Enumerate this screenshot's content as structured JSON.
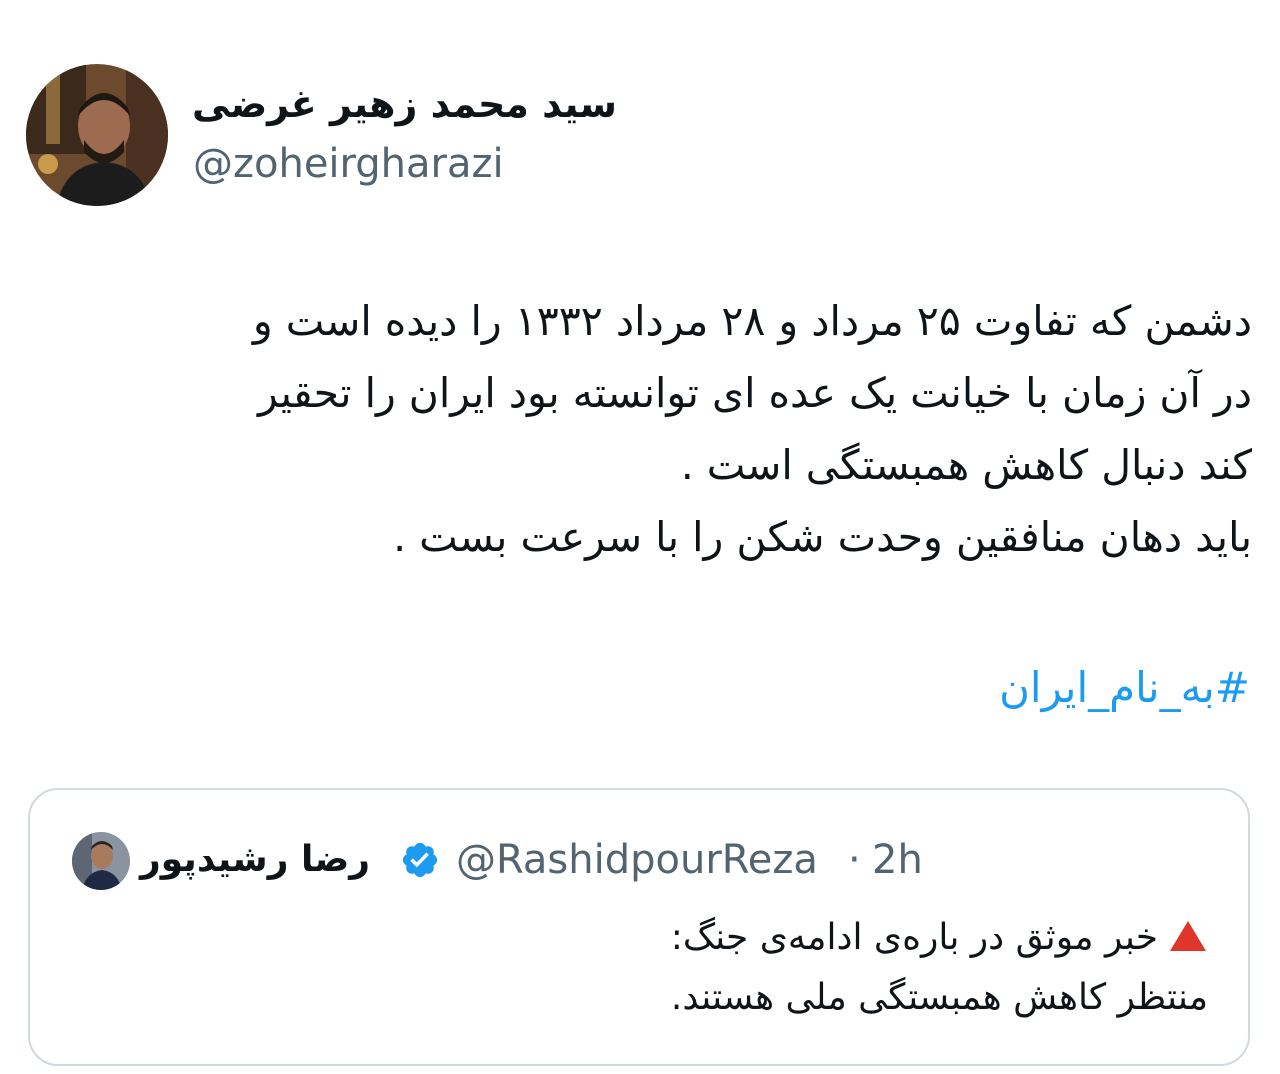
{
  "author": {
    "display_name": "سید محمد زهیر غرضی",
    "handle": "@zoheirgharazi"
  },
  "tweet": {
    "lines": [
      "دشمن که تفاوت ۲۵ مرداد و ۲۸ مرداد ۱۳۳۲ را دیده است و",
      "در آن زمان با خیانت یک عده ای توانسته بود ایران را تحقیر",
      "کند دنبال کاهش همبستگی است .",
      "باید دهان منافقین وحدت شکن را با سرعت بست ."
    ],
    "hashtag": "#به_نام_ایران"
  },
  "quoted_tweet": {
    "display_name": "رضا رشیدپور",
    "verified": true,
    "handle": "@RashidpourReza",
    "separator": "·",
    "time": "2h",
    "lines": [
      "خبر موثق در باره‌ی ادامه‌ی جنگ:",
      "منتظر کاهش همبستگی ملی هستند."
    ],
    "leading_icon": "red-triangle-icon"
  },
  "colors": {
    "text": "#0f1419",
    "secondary": "#536471",
    "link": "#1d9bf0",
    "border": "#cfd9de",
    "verified": "#1d9bf0",
    "warning": "#e0352b"
  }
}
